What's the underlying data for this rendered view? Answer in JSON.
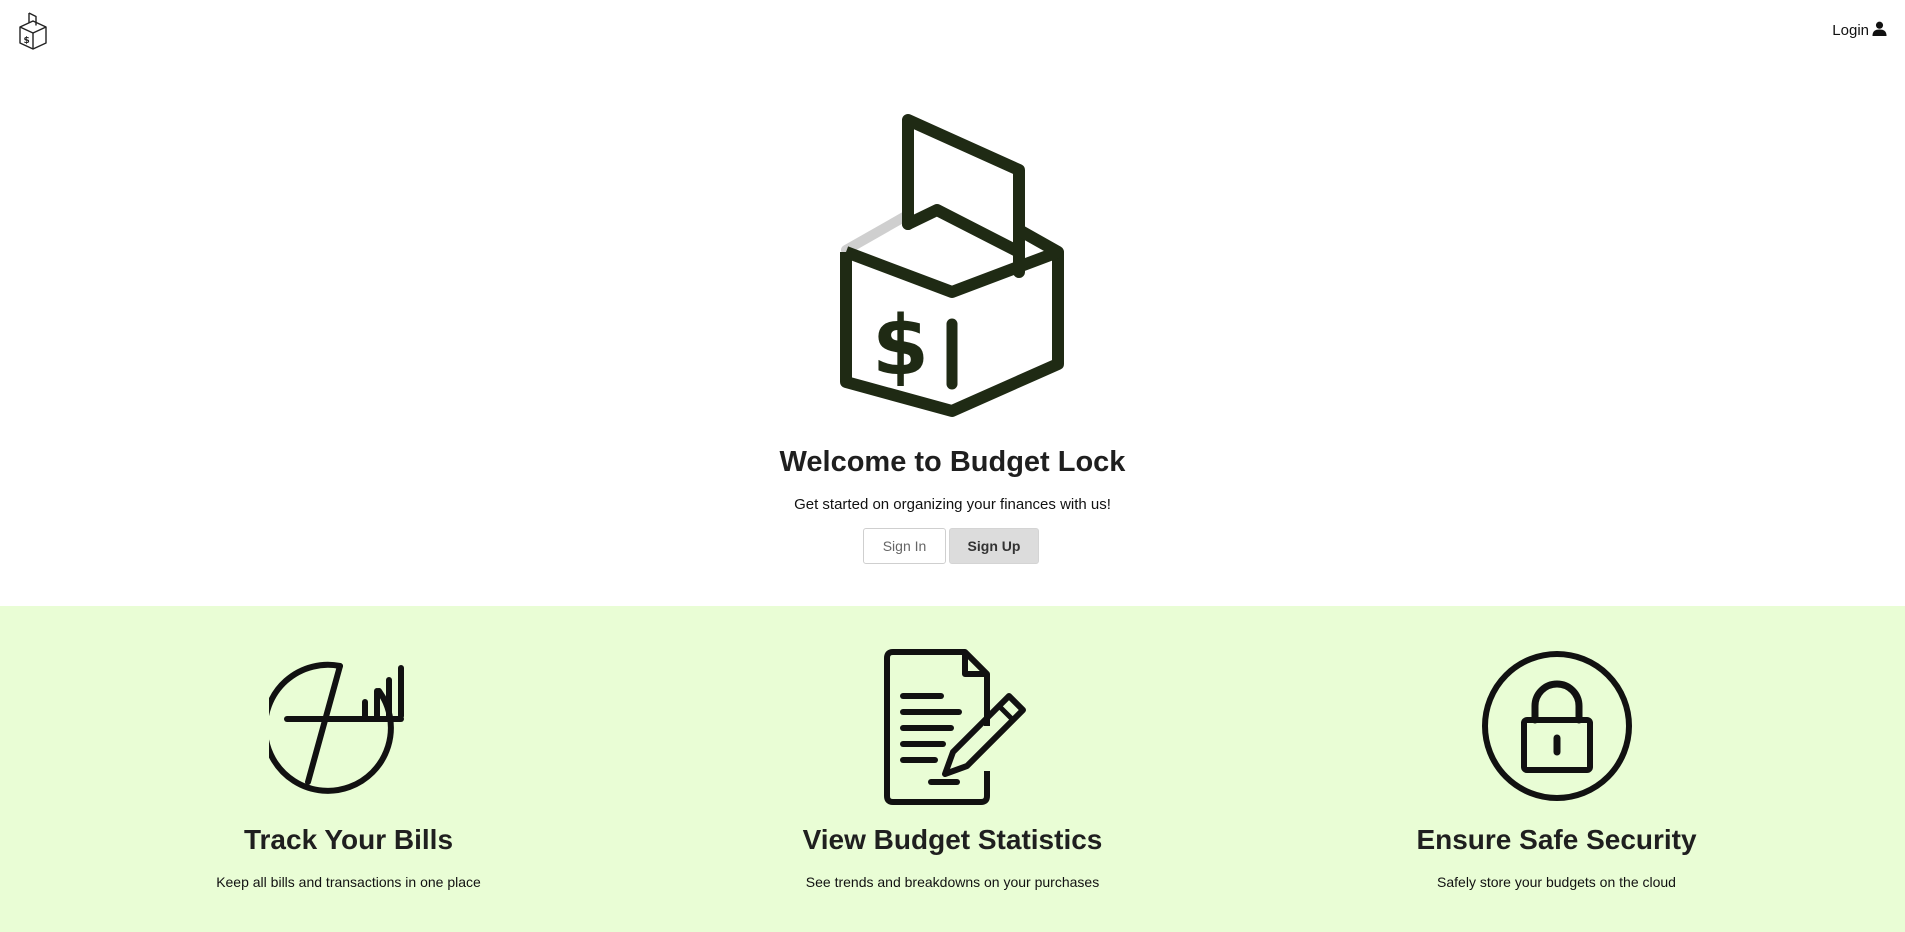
{
  "header": {
    "logo_icon": "budget-box-icon",
    "login_label": "Login",
    "login_icon": "user-icon"
  },
  "hero": {
    "logo_icon": "budget-box-icon",
    "title": "Welcome to Budget Lock",
    "subtitle": "Get started on organizing your finances with us!",
    "signin_label": "Sign In",
    "signup_label": "Sign Up"
  },
  "features": [
    {
      "icon": "pie-bar-chart-icon",
      "title": "Track Your Bills",
      "description": "Keep all bills and transactions in one place"
    },
    {
      "icon": "document-pen-icon",
      "title": "View Budget Statistics",
      "description": "See trends and breakdowns on your purchases"
    },
    {
      "icon": "lock-circle-icon",
      "title": "Ensure Safe Security",
      "description": "Safely store your budgets on the cloud"
    }
  ],
  "colors": {
    "background": "#ffffff",
    "features_background": "#e9fdd5",
    "icon_dark": "#1f2a14",
    "signup_button_bg": "#dcdcdc"
  }
}
